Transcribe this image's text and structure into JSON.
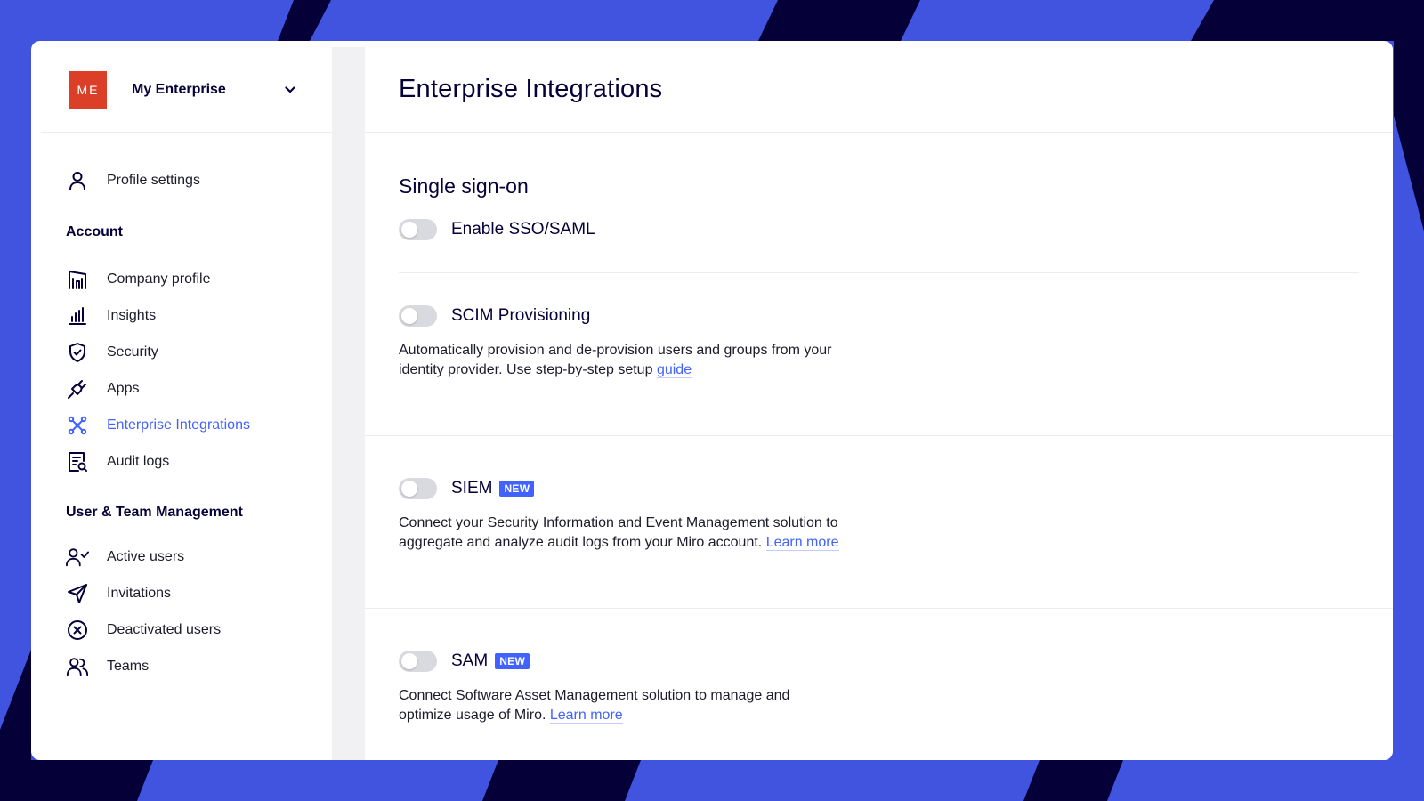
{
  "colors": {
    "accent": "#4262ff",
    "background": "#4154e0",
    "logo": "#dc3f28",
    "stripes": "#050038"
  },
  "sidebar": {
    "org": {
      "logo_text": "ME",
      "name": "My Enterprise",
      "dropdown_icon": "chevron-down-icon"
    },
    "profile": {
      "label": "Profile settings",
      "icon": "user-icon"
    },
    "account": {
      "title": "Account",
      "items": [
        {
          "label": "Company profile",
          "icon": "building-icon"
        },
        {
          "label": "Insights",
          "icon": "bar-chart-icon"
        },
        {
          "label": "Security",
          "icon": "shield-check-icon"
        },
        {
          "label": "Apps",
          "icon": "plug-icon"
        },
        {
          "label": "Enterprise Integrations",
          "icon": "integrations-icon",
          "active": true
        },
        {
          "label": "Audit logs",
          "icon": "audit-log-icon"
        }
      ]
    },
    "user_team": {
      "title": "User & Team Management",
      "items": [
        {
          "label": "Active users",
          "icon": "user-check-icon"
        },
        {
          "label": "Invitations",
          "icon": "send-icon"
        },
        {
          "label": "Deactivated users",
          "icon": "circle-x-icon"
        },
        {
          "label": "Teams",
          "icon": "users-icon"
        }
      ]
    }
  },
  "main": {
    "title": "Enterprise Integrations",
    "sso": {
      "heading": "Single sign-on",
      "toggle_label": "Enable SSO/SAML",
      "enabled": false
    },
    "scim": {
      "toggle_label": "SCIM Provisioning",
      "enabled": false,
      "description": "Automatically provision and de-provision users and groups from your identity provider. Use step-by-step setup",
      "link": "guide"
    },
    "siem": {
      "toggle_label": "SIEM",
      "enabled": false,
      "badge": "NEW",
      "description": "Connect your Security Information and Event Management solution to aggregate and analyze audit logs from your Miro account.",
      "link": "Learn more"
    },
    "sam": {
      "toggle_label": "SAM",
      "enabled": false,
      "badge": "NEW",
      "description": "Connect Software Asset Management solution to manage and optimize usage of Miro.",
      "link": "Learn more"
    }
  }
}
